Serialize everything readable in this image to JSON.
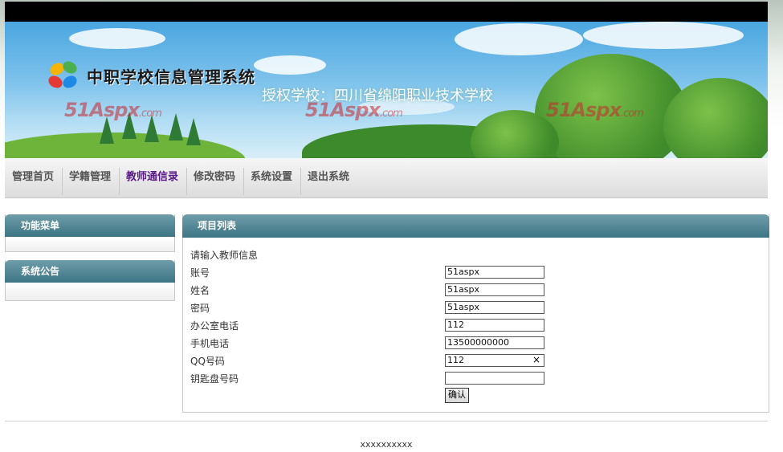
{
  "header": {
    "system_title": "中职学校信息管理系统",
    "school": "授权学校：四川省绵阳职业技术学校",
    "brand_main": "51Aspx",
    "brand_suffix": ".com"
  },
  "nav": {
    "items": [
      {
        "label": "管理首页"
      },
      {
        "label": "学籍管理"
      },
      {
        "label": "教师通信录",
        "active": true
      },
      {
        "label": "修改密码"
      },
      {
        "label": "系统设置"
      },
      {
        "label": "退出系统"
      }
    ]
  },
  "sidebar": {
    "menu_title": "功能菜单",
    "notice_title": "系统公告"
  },
  "main": {
    "title": "项目列表",
    "intro": "请输入教师信息",
    "fields": [
      {
        "label": "账号",
        "value": "51aspx"
      },
      {
        "label": "姓名",
        "value": "51aspx"
      },
      {
        "label": "密码",
        "value": "51aspx"
      },
      {
        "label": "办公室电话",
        "value": "112"
      },
      {
        "label": "手机电话",
        "value": "13500000000"
      },
      {
        "label": "QQ号码",
        "value": "112",
        "clear_icon": "×"
      },
      {
        "label": "钥匙盘号码",
        "value": ""
      }
    ],
    "confirm_label": "确认"
  },
  "footer": {
    "text": "xxxxxxxxxx"
  },
  "colors": {
    "panel_header": "#3d7584",
    "active_nav": "#5a1a8a",
    "brand": "#c8282d"
  }
}
